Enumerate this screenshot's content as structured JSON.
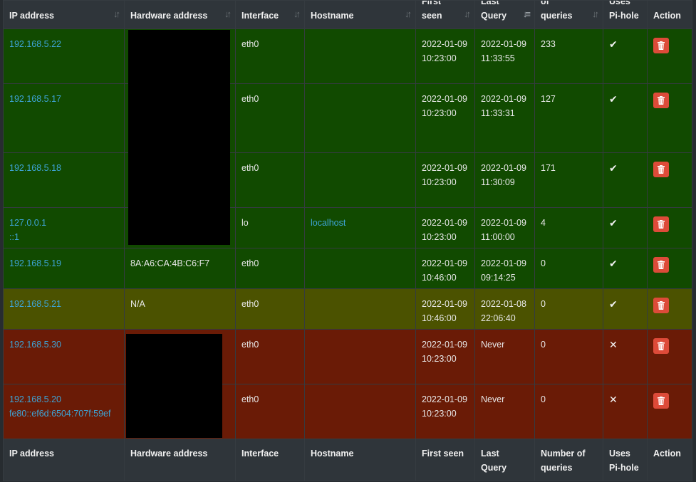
{
  "headers": [
    {
      "line1": "IP address",
      "line2": ""
    },
    {
      "line1": "Hardware address",
      "line2": ""
    },
    {
      "line1": "Interface",
      "line2": ""
    },
    {
      "line1": "Hostname",
      "line2": ""
    },
    {
      "line1": "First",
      "line2": "seen"
    },
    {
      "line1": "Last",
      "line2": "Query"
    },
    {
      "line1": "of",
      "line2": "queries"
    },
    {
      "line1": "Uses",
      "line2": "Pi-hole"
    },
    {
      "line1": "Action",
      "line2": ""
    }
  ],
  "rows": [
    {
      "status": "green",
      "ip": [
        "192.168.5.22"
      ],
      "hw": "",
      "iface": "eth0",
      "host": "",
      "first_date": "2022-01-09",
      "first_time": "10:23:00",
      "last_date": "2022-01-09",
      "last_time": "11:33:55",
      "queries": "233",
      "uses": "✔"
    },
    {
      "status": "green",
      "ip": [
        "192.168.5.17"
      ],
      "hw": "",
      "iface": "eth0",
      "host": "",
      "first_date": "2022-01-09",
      "first_time": "10:23:00",
      "last_date": "2022-01-09",
      "last_time": "11:33:31",
      "queries": "127",
      "uses": "✔"
    },
    {
      "status": "green",
      "ip": [
        "192.168.5.18"
      ],
      "hw": "",
      "iface": "eth0",
      "host": "",
      "first_date": "2022-01-09",
      "first_time": "10:23:00",
      "last_date": "2022-01-09",
      "last_time": "11:30:09",
      "queries": "171",
      "uses": "✔"
    },
    {
      "status": "green",
      "ip": [
        "127.0.0.1",
        "::1"
      ],
      "hw": "",
      "iface": "lo",
      "host": "localhost",
      "first_date": "2022-01-09",
      "first_time": "10:23:00",
      "last_date": "2022-01-09",
      "last_time": "11:00:00",
      "queries": "4",
      "uses": "✔"
    },
    {
      "status": "green",
      "ip": [
        "192.168.5.19"
      ],
      "hw": "8A:A6:CA:4B:C6:F7",
      "iface": "eth0",
      "host": "",
      "first_date": "2022-01-09",
      "first_time": "10:46:00",
      "last_date": "2022-01-09",
      "last_time": "09:14:25",
      "queries": "0",
      "uses": "✔"
    },
    {
      "status": "yellow",
      "ip": [
        "192.168.5.21"
      ],
      "hw": "N/A",
      "iface": "eth0",
      "host": "",
      "first_date": "2022-01-09",
      "first_time": "10:46:00",
      "last_date": "2022-01-08",
      "last_time": "22:06:40",
      "queries": "0",
      "uses": "✔"
    },
    {
      "status": "red",
      "ip": [
        "192.168.5.30"
      ],
      "hw": "",
      "iface": "eth0",
      "host": "",
      "first_date": "2022-01-09",
      "first_time": "10:23:00",
      "last_date": "Never",
      "last_time": "",
      "queries": "0",
      "uses": "✕"
    },
    {
      "status": "red",
      "ip": [
        "192.168.5.20",
        "fe80::ef6d:6504:707f:59ef"
      ],
      "hw": "",
      "iface": "eth0",
      "host": "",
      "first_date": "2022-01-09",
      "first_time": "10:23:00",
      "last_date": "Never",
      "last_time": "",
      "queries": "0",
      "uses": "✕"
    }
  ],
  "footers": [
    {
      "line1": "IP address",
      "line2": ""
    },
    {
      "line1": "Hardware address",
      "line2": ""
    },
    {
      "line1": "Interface",
      "line2": ""
    },
    {
      "line1": "Hostname",
      "line2": ""
    },
    {
      "line1": "First seen",
      "line2": ""
    },
    {
      "line1": "Last",
      "line2": "Query"
    },
    {
      "line1": "Number of",
      "line2": "queries"
    },
    {
      "line1": "Uses",
      "line2": "Pi-hole"
    },
    {
      "line1": "Action",
      "line2": ""
    }
  ],
  "colors": {
    "green": "#114a00",
    "yellow": "#4b5200",
    "red": "#6a1b06",
    "link": "#3ea4d6",
    "delete": "#dd4b39"
  },
  "icons": {
    "sort": "sort-arrows-icon",
    "delete": "trash-icon",
    "uses_yes": "check-icon",
    "uses_no": "cross-icon"
  }
}
